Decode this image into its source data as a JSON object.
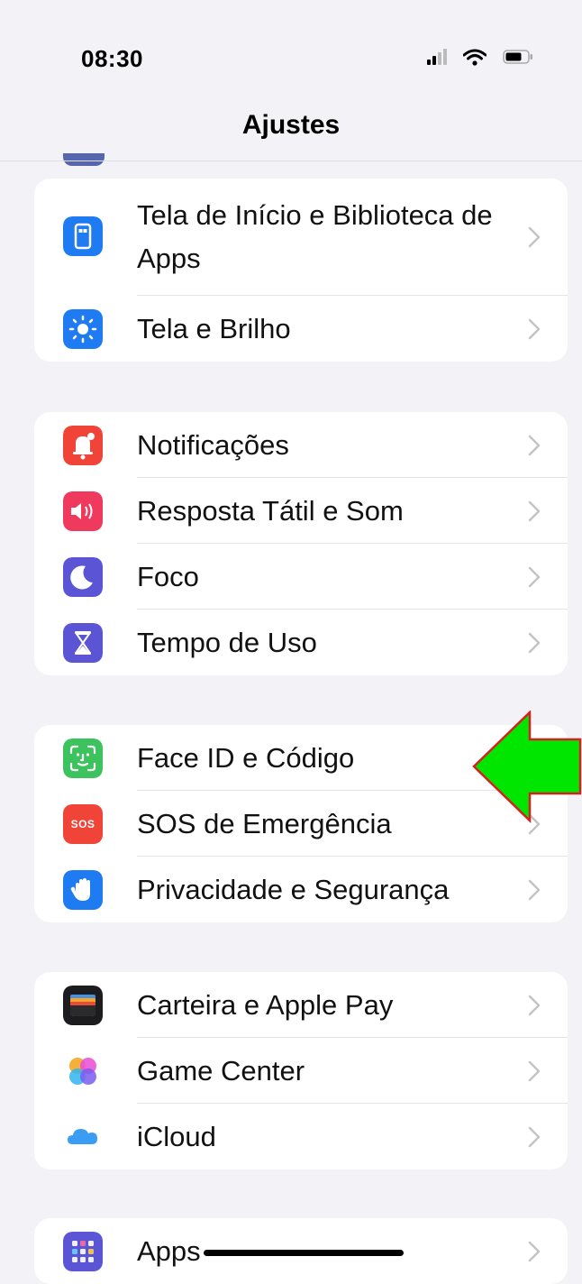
{
  "status_bar": {
    "time": "08:30"
  },
  "nav": {
    "title": "Ajustes"
  },
  "groups": [
    {
      "items": [
        {
          "label": "Tela de Início e Biblioteca de Apps",
          "icon": "home-screen-icon",
          "color": "#1f7bf2"
        },
        {
          "label": "Tela e Brilho",
          "icon": "brightness-icon",
          "color": "#1f7bf2"
        }
      ]
    },
    {
      "items": [
        {
          "label": "Notificações",
          "icon": "notifications-icon",
          "color": "#f04438"
        },
        {
          "label": "Resposta Tátil e Som",
          "icon": "speaker-icon",
          "color": "#ef3a5d"
        },
        {
          "label": "Foco",
          "icon": "moon-icon",
          "color": "#5b55d6"
        },
        {
          "label": "Tempo de Uso",
          "icon": "hourglass-icon",
          "color": "#5b55d6"
        }
      ]
    },
    {
      "items": [
        {
          "label": "Face ID e Código",
          "icon": "face-id-icon",
          "color": "#3cc35d"
        },
        {
          "label": "SOS de Emergência",
          "icon": "sos-icon",
          "color": "#f04438",
          "icon_text": "SOS"
        },
        {
          "label": "Privacidade e Segurança",
          "icon": "hand-icon",
          "color": "#1f7bf2"
        }
      ]
    },
    {
      "items": [
        {
          "label": "Carteira e Apple Pay",
          "icon": "wallet-icon",
          "color": "#1c1c1e"
        },
        {
          "label": "Game Center",
          "icon": "game-center-icon",
          "color": "#ffffff"
        },
        {
          "label": "iCloud",
          "icon": "icloud-icon",
          "color": "#ffffff"
        }
      ]
    },
    {
      "items": [
        {
          "label": "Apps",
          "icon": "apps-icon",
          "color": "#5b55d6"
        }
      ]
    }
  ],
  "annotation": {
    "icon": "arrow-left-icon",
    "color": "#00e600",
    "border_color": "#d62020"
  }
}
